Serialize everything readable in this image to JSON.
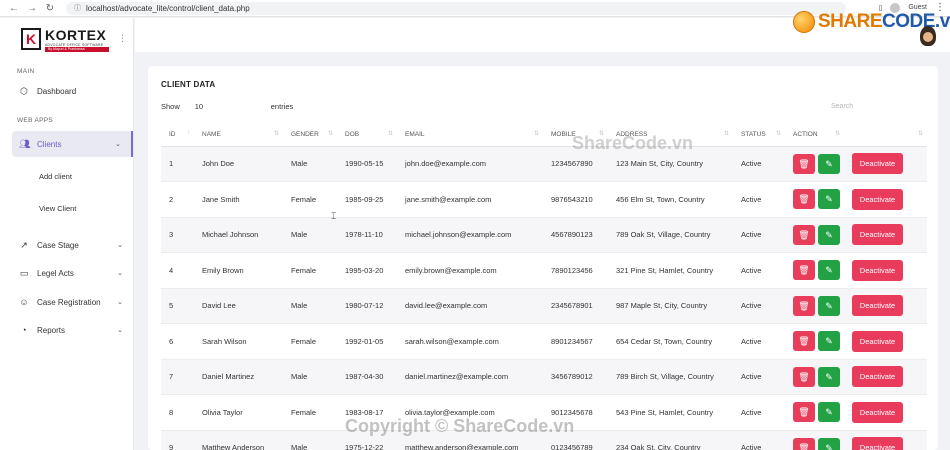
{
  "browser": {
    "url": "localhost/advocate_lite/control/client_data.php",
    "profile": "Guest"
  },
  "watermark": {
    "logo_share": "SHARE",
    "logo_code": "CODE.vn",
    "center": "ShareCode.vn",
    "bottom": "Copyright © ShareCode.vn"
  },
  "brand": {
    "letter": "K",
    "name": "KORTEX",
    "tagline": "ADVOCATE OFFICE SOFTWARE",
    "by": "By Mayuri & Prashansa"
  },
  "sidebar": {
    "main_title": "MAIN",
    "dashboard": "Dashboard",
    "webapps_title": "WEB APPS",
    "clients": "Clients",
    "add_client": "Add client",
    "view_client": "View Client",
    "case_stage": "Case Stage",
    "legel_acts": "Legel Acts",
    "case_registration": "Case Registration",
    "reports": "Reports"
  },
  "card": {
    "title": "CLIENT DATA",
    "show_label": "Show",
    "show_value": "10",
    "entries_label": "entries",
    "search_placeholder": "Search"
  },
  "table": {
    "headers": [
      "ID",
      "NAME",
      "GENDER",
      "DOB",
      "EMAIL",
      "MOBILE",
      "ADDRESS",
      "STATUS",
      "ACTION",
      ""
    ],
    "deactivate_label": "Deactivate",
    "rows": [
      {
        "id": "1",
        "name": "John Doe",
        "gender": "Male",
        "dob": "1990-05-15",
        "email": "john.doe@example.com",
        "mobile": "1234567890",
        "address": "123 Main St, City, Country",
        "status": "Active"
      },
      {
        "id": "2",
        "name": "Jane Smith",
        "gender": "Female",
        "dob": "1985-09-25",
        "email": "jane.smith@example.com",
        "mobile": "9876543210",
        "address": "456 Elm St, Town, Country",
        "status": "Active"
      },
      {
        "id": "3",
        "name": "Michael Johnson",
        "gender": "Male",
        "dob": "1978-11-10",
        "email": "michael.johnson@example.com",
        "mobile": "4567890123",
        "address": "789 Oak St, Village, Country",
        "status": "Active"
      },
      {
        "id": "4",
        "name": "Emily Brown",
        "gender": "Female",
        "dob": "1995-03-20",
        "email": "emily.brown@example.com",
        "mobile": "7890123456",
        "address": "321 Pine St, Hamlet, Country",
        "status": "Active"
      },
      {
        "id": "5",
        "name": "David Lee",
        "gender": "Male",
        "dob": "1980-07-12",
        "email": "david.lee@example.com",
        "mobile": "2345678901",
        "address": "987 Maple St, City, Country",
        "status": "Active"
      },
      {
        "id": "6",
        "name": "Sarah Wilson",
        "gender": "Female",
        "dob": "1992-01-05",
        "email": "sarah.wilson@example.com",
        "mobile": "8901234567",
        "address": "654 Cedar St, Town, Country",
        "status": "Active"
      },
      {
        "id": "7",
        "name": "Daniel Martinez",
        "gender": "Male",
        "dob": "1987-04-30",
        "email": "daniel.martinez@example.com",
        "mobile": "3456789012",
        "address": "789 Birch St, Village, Country",
        "status": "Active"
      },
      {
        "id": "8",
        "name": "Olivia Taylor",
        "gender": "Female",
        "dob": "1983-08-17",
        "email": "olivia.taylor@example.com",
        "mobile": "9012345678",
        "address": "543 Pine St, Hamlet, Country",
        "status": "Active"
      },
      {
        "id": "9",
        "name": "Matthew Anderson",
        "gender": "Male",
        "dob": "1975-12-22",
        "email": "matthew.anderson@example.com",
        "mobile": "0123456789",
        "address": "234 Oak St, City, Country",
        "status": "Active"
      }
    ]
  }
}
